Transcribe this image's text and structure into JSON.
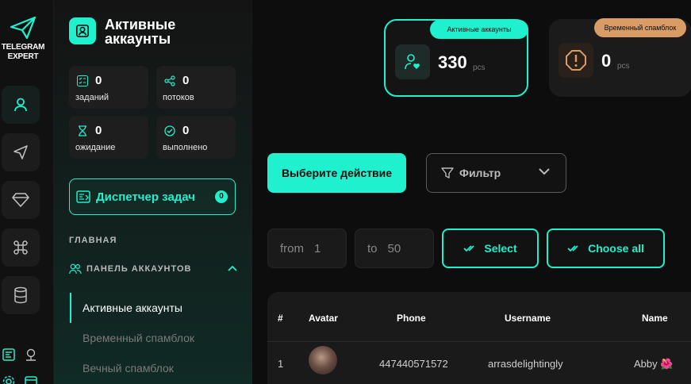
{
  "brand": {
    "line1": "TELEGRAM",
    "line2": "EXPERT"
  },
  "sidebar": {
    "title": "Активные аккаунты",
    "stats": [
      {
        "value": "0",
        "label": "заданий"
      },
      {
        "value": "0",
        "label": "потоков"
      },
      {
        "value": "0",
        "label": "ожидание"
      },
      {
        "value": "0",
        "label": "выполнено"
      }
    ],
    "dispatcher": {
      "label": "Диспетчер задач",
      "badge": "0"
    },
    "section_main": "ГЛАВНАЯ",
    "section_panel": "ПАНЕЛЬ АККАУНТОВ",
    "nav": [
      {
        "label": "Активные аккаунты",
        "active": true
      },
      {
        "label": "Временный спамблок",
        "active": false
      },
      {
        "label": "Вечный спамблок",
        "active": false
      }
    ]
  },
  "cards": {
    "active": {
      "pill": "Активные аккаунты",
      "value": "330",
      "unit": "pcs"
    },
    "spamblock": {
      "pill": "Временный спамблок",
      "value": "0",
      "unit": "pcs"
    }
  },
  "toolbar": {
    "action_label": "Выберите действие",
    "filter_label": "Фильтр",
    "from_label": "from",
    "from_value": "1",
    "to_label": "to",
    "to_value": "50",
    "select_label": "Select",
    "choose_all_label": "Choose all"
  },
  "table": {
    "columns": [
      "#",
      "Avatar",
      "Phone",
      "Username",
      "Name"
    ],
    "rows": [
      {
        "num": "1",
        "phone": "447440571572",
        "username": "arrasdelightingly",
        "name": "Abby 🌺"
      }
    ]
  },
  "colors": {
    "accent": "#1ff0cd",
    "warning": "#d99c66",
    "background": "#0d0d0d"
  }
}
